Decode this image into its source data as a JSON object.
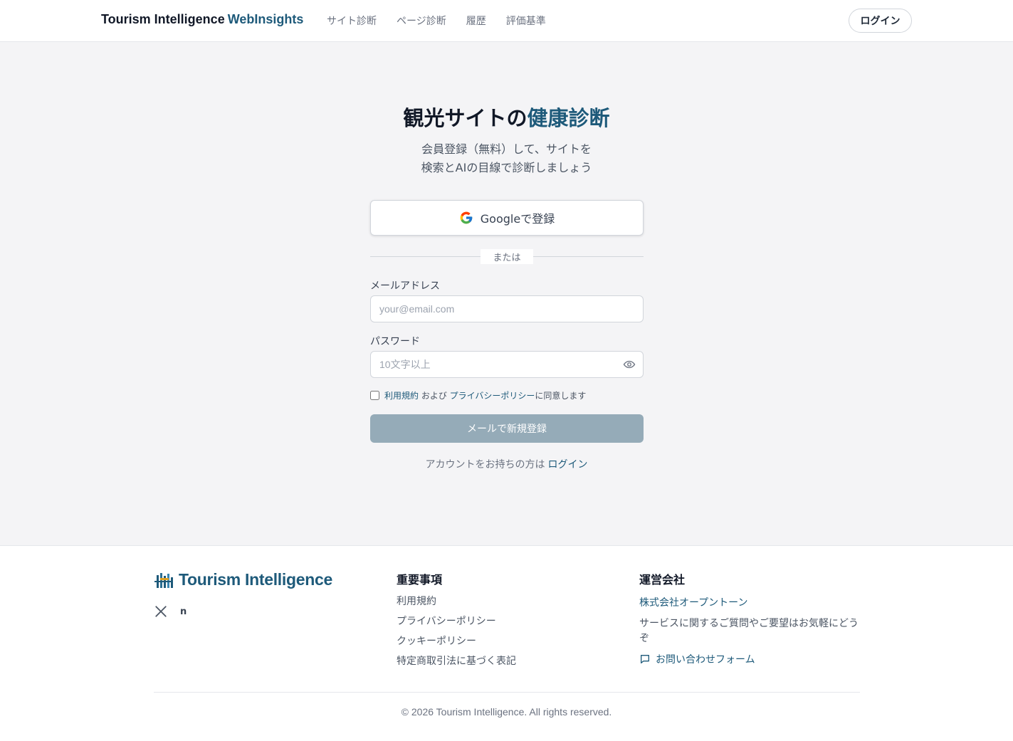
{
  "header": {
    "brand_main": "Tourism Intelligence",
    "brand_accent": "WebInsights",
    "nav": [
      "サイト診断",
      "ページ診断",
      "履歴",
      "評価基準"
    ],
    "login_label": "ログイン"
  },
  "hero": {
    "title_main": "観光サイトの",
    "title_accent": "健康診断",
    "subtitle_line1": "会員登録（無料）して、サイトを",
    "subtitle_line2": "検索とAIの目線で診断しましょう"
  },
  "form": {
    "google_label": "Googleで登録",
    "divider_label": "または",
    "email_label": "メールアドレス",
    "email_placeholder": "your@email.com",
    "password_label": "パスワード",
    "password_placeholder": "10文字以上",
    "terms_link": "利用規約",
    "terms_and": " および ",
    "privacy_link": "プライバシーポリシー",
    "terms_suffix": "に同意します",
    "submit_label": "メールで新規登録",
    "have_account": "アカウントをお持ちの方は",
    "login_link": "ログイン"
  },
  "footer": {
    "logo_text": "Tourism Intelligence",
    "social_note": "n",
    "important_title": "重要事項",
    "important_links": [
      "利用規約",
      "プライバシーポリシー",
      "クッキーポリシー",
      "特定商取引法に基づく表記"
    ],
    "company_title": "運営会社",
    "company_name": "株式会社オープントーン",
    "company_desc": "サービスに関するご質問やご要望はお気軽にどうぞ",
    "contact_label": "お問い合わせフォーム",
    "copyright": "© 2026 Tourism Intelligence. All rights reserved."
  },
  "colors": {
    "accent": "#1e5a7a",
    "submit_disabled": "#95abb8",
    "background": "#f4f4f6"
  }
}
